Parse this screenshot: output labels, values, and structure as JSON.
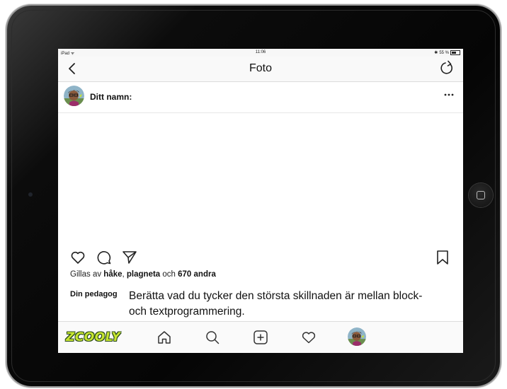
{
  "status_bar": {
    "device": "iPad",
    "time": "11:06",
    "battery": "55 %"
  },
  "nav": {
    "title": "Foto",
    "back_icon": "chevron-left-icon",
    "refresh_icon": "refresh-icon"
  },
  "post": {
    "username": "Ditt namn:",
    "more_icon": "more-horizontal-icon",
    "likes": {
      "prefix": "Gillas av ",
      "user1": "håke",
      "sep1": ", ",
      "user2": "plagneta",
      "sep2": " och ",
      "others": "670 andra"
    },
    "caption_user": "Din pedagog",
    "caption_text": "Berätta vad du tycker den största skillnaden är mellan block- och textprogrammering."
  },
  "actions": [
    "heart-icon",
    "comment-icon",
    "share-icon",
    "bookmark-icon"
  ],
  "tabbar": {
    "logo": "ZCOOLY",
    "tabs": [
      "home-icon",
      "search-icon",
      "add-icon",
      "heart-icon",
      "profile-avatar"
    ]
  },
  "colors": {
    "logo_fill": "#c7e531",
    "logo_outline": "#2a4a1a",
    "frame": "#0c0c0c"
  }
}
